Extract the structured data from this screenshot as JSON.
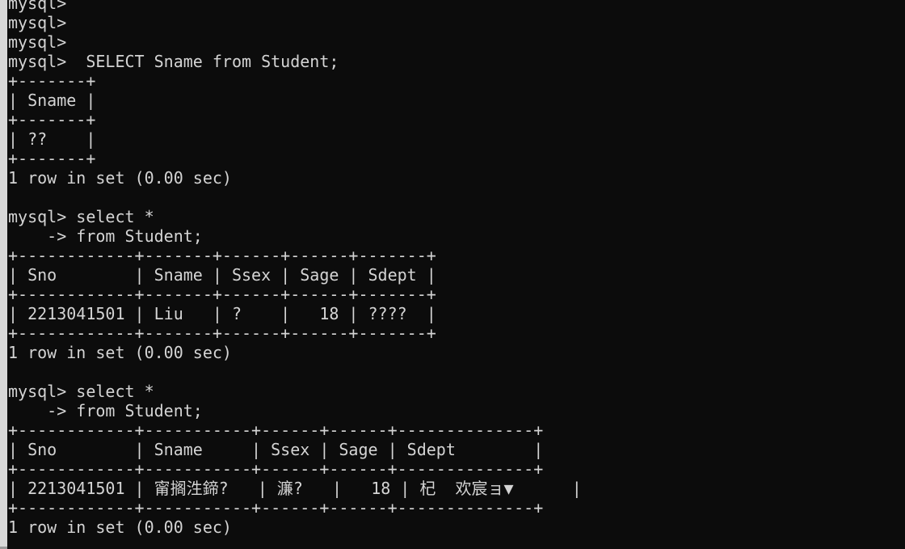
{
  "terminal": {
    "colors": {
      "background": "#0c0c0c",
      "foreground": "#d4d4d4",
      "window_edge": "#d8d8d8"
    },
    "lines": [
      "mysql>",
      "mysql>",
      "mysql>",
      "mysql>  SELECT Sname from Student;",
      "+-------+",
      "| Sname |",
      "+-------+",
      "| ??    |",
      "+-------+",
      "1 row in set (0.00 sec)",
      "",
      "mysql> select *",
      "    -> from Student;",
      "+------------+-------+------+------+-------+",
      "| Sno        | Sname | Ssex | Sage | Sdept |",
      "+------------+-------+------+------+-------+",
      "| 2213041501 | Liu   | ?    |   18 | ????  |",
      "+------------+-------+------+------+-------+",
      "1 row in set (0.00 sec)",
      "",
      "mysql> select *",
      "    -> from Student;",
      "+------------+-----------+------+------+--------------+",
      "| Sno        | Sname     | Ssex | Sage | Sdept        |",
      "+------------+-----------+------+------+--------------+",
      "| 2213041501 | 甯搁泩鍗?   | 濂?   |   18 | 杞  欢宸ョ▼      |",
      "+------------+-----------+------+------+--------------+",
      "1 row in set (0.00 sec)"
    ]
  }
}
